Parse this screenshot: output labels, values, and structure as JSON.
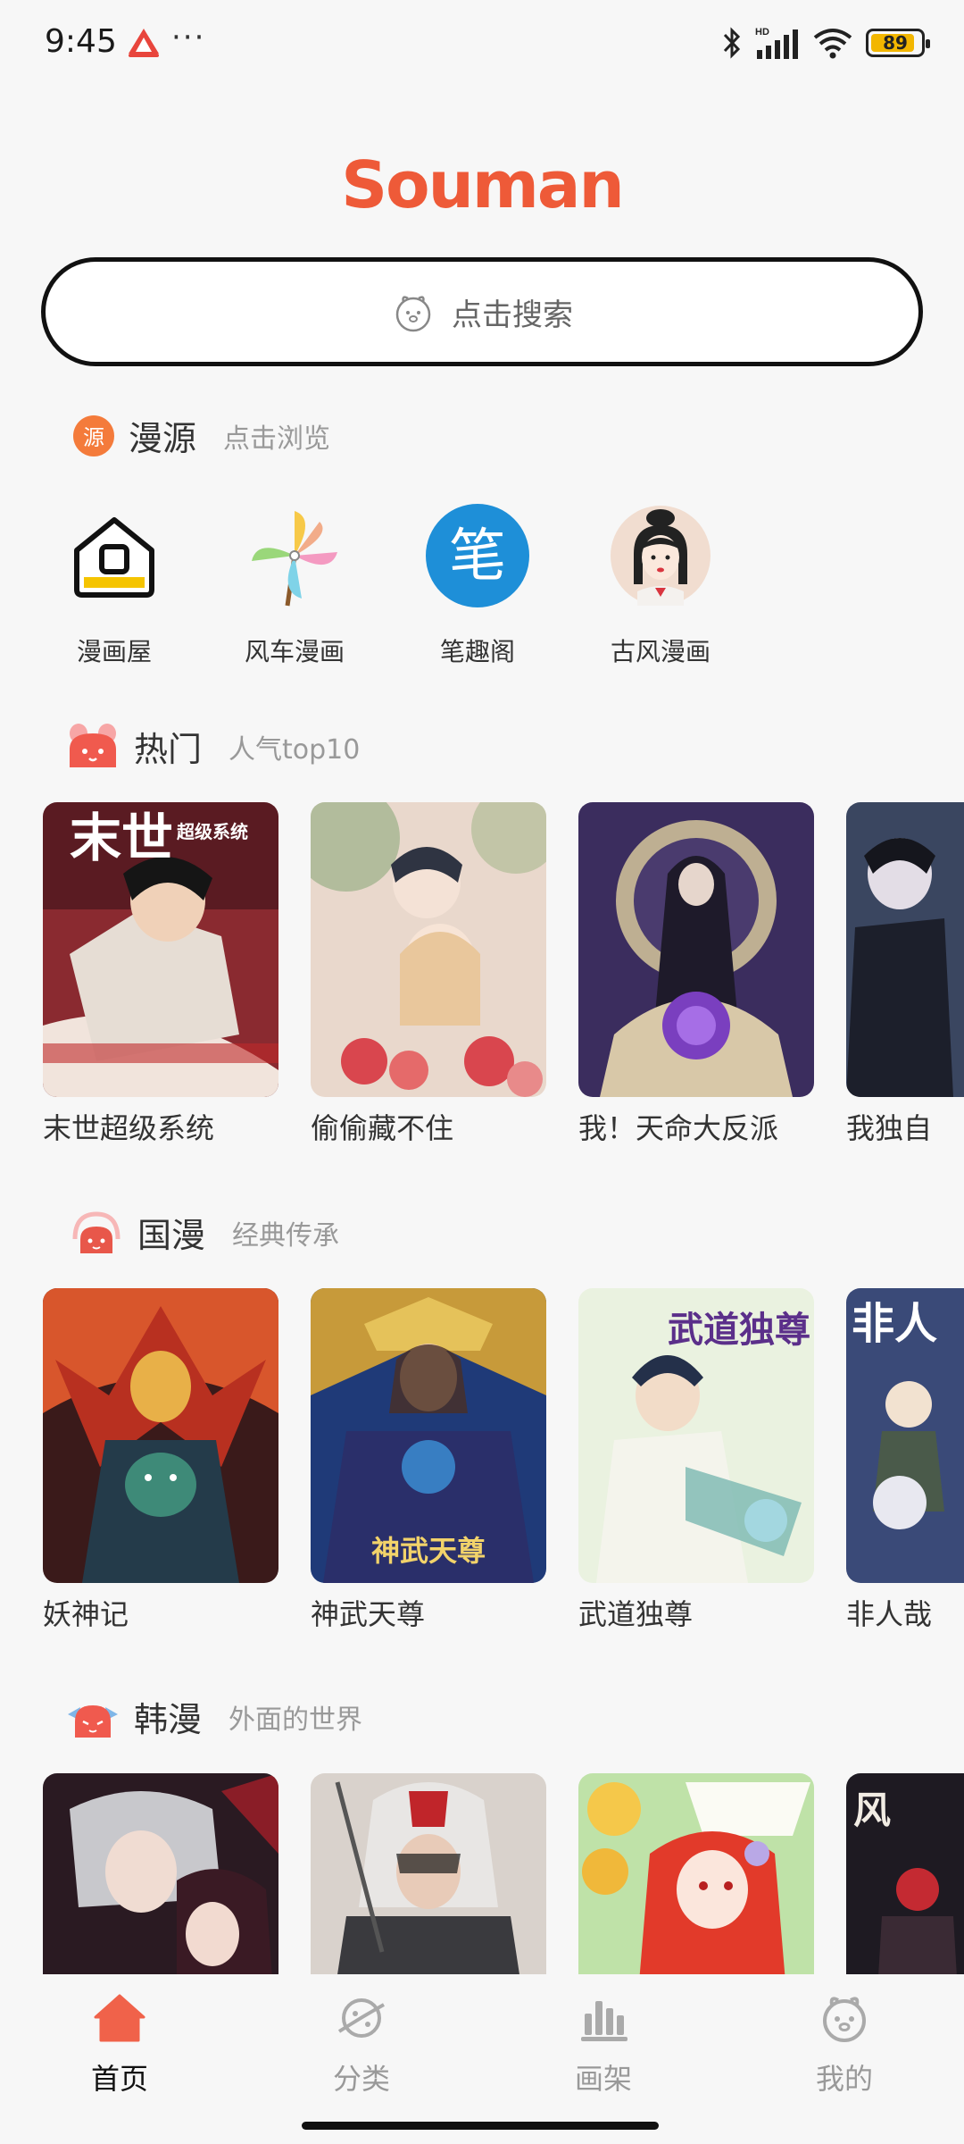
{
  "status": {
    "time": "9:45",
    "dots": "···",
    "battery": "89",
    "battery_level": 0.89,
    "hd_label": "HD"
  },
  "brand": {
    "logo_text": "Souman",
    "accent": "#ee5a38"
  },
  "search": {
    "placeholder": "点击搜索",
    "icon": "face-icon"
  },
  "sources_section": {
    "badge": "源",
    "title": "漫源",
    "subtitle": "点击浏览",
    "items": [
      {
        "label": "漫画屋",
        "icon": "house-icon"
      },
      {
        "label": "风车漫画",
        "icon": "pinwheel-icon"
      },
      {
        "label": "笔趣阁",
        "icon": "brush-icon",
        "icon_text": "笔"
      },
      {
        "label": "古风漫画",
        "icon": "ancient-girl-icon"
      }
    ]
  },
  "hot_section": {
    "title": "热门",
    "subtitle": "人气top10",
    "comics": [
      {
        "title": "末世超级系统",
        "cover_text": "末世",
        "cover_text2": "超级系统"
      },
      {
        "title": "偷偷藏不住"
      },
      {
        "title": "我！天命大反派"
      },
      {
        "title": "我独自"
      }
    ]
  },
  "guoman_section": {
    "title": "国漫",
    "subtitle": "经典传承",
    "comics": [
      {
        "title": "妖神记"
      },
      {
        "title": "神武天尊",
        "cover_text": "神武天尊"
      },
      {
        "title": "武道独尊",
        "cover_text": "武道独尊"
      },
      {
        "title": "非人哉",
        "cover_text": "非人"
      }
    ]
  },
  "hanman_section": {
    "title": "韩漫",
    "subtitle": "外面的世界",
    "comics": [
      {
        "title": ""
      },
      {
        "title": ""
      },
      {
        "title": ""
      },
      {
        "title": "",
        "cover_text": "风"
      }
    ]
  },
  "nav": {
    "items": [
      {
        "label": "首页",
        "icon": "home-icon",
        "active": true
      },
      {
        "label": "分类",
        "icon": "planet-icon",
        "active": false
      },
      {
        "label": "画架",
        "icon": "shelf-icon",
        "active": false
      },
      {
        "label": "我的",
        "icon": "face-icon",
        "active": false
      }
    ]
  }
}
